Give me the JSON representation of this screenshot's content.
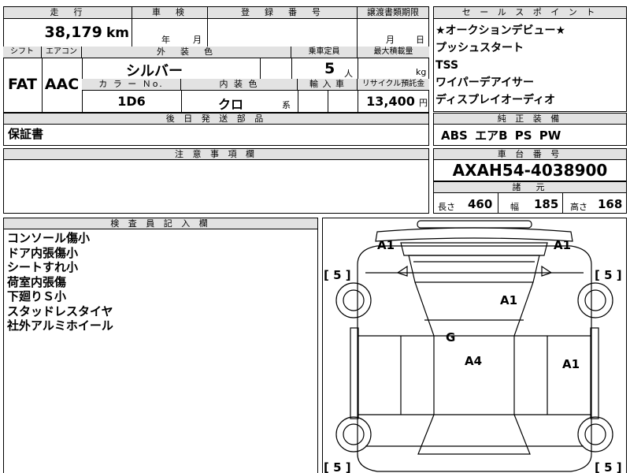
{
  "top_left": {
    "headers": {
      "mileage": "走　行",
      "shaken": "車　検",
      "reg_no": "登　録　番　号",
      "transfer": "譲渡書類期限"
    },
    "mileage_value": "38,179",
    "mileage_unit": "km",
    "shaken_year": "年",
    "shaken_month": "月",
    "transfer_month": "月",
    "transfer_day": "日",
    "row2_headers": {
      "shift": "シフト",
      "aircon": "エアコン",
      "exterior": "外　装　色",
      "capacity": "乗車定員",
      "max_load": "最大積載量"
    },
    "shift": "FAT",
    "aircon": "AAC",
    "exterior_color": "シルバー",
    "capacity_value": "5",
    "capacity_unit": "人",
    "load_unit": "kg",
    "row3_headers": {
      "color_no": "カ ラ ー Ｎo.",
      "interior": "内 装 色",
      "import": "輸 入 車",
      "recycle": "リサイクル預託金"
    },
    "color_no": "1D6",
    "interior_color": "クロ",
    "interior_suffix": "系",
    "recycle_value": "13,400",
    "recycle_unit": "円",
    "delivery_header": "後 日 発 送 部 品",
    "delivery_item": "保証書",
    "notes_header": "注 意 事 項 欄"
  },
  "right": {
    "sales_header": "セ ー ル ス ポ イ ン ト",
    "sales_points": [
      "★オークションデビュー★",
      "プッシュスタート",
      "TSS",
      "ワイパーデアイサー",
      "ディスプレイオーディオ"
    ],
    "equipment_header": "純 正 装 備",
    "equipment": "ABS エアB PS PW",
    "chassis_header": "車 台 番 号",
    "chassis_no": "AXAH54-4038900",
    "spec_header": "諸　元",
    "length_label": "長さ",
    "length": "460",
    "width_label": "幅",
    "width": "185",
    "height_label": "高さ",
    "height": "168"
  },
  "inspector": {
    "header": "検 査 員 記 入 欄",
    "notes": [
      "コンソール傷小",
      "ドア内張傷小",
      "シートすれ小",
      "荷室内張傷",
      "下廻りＳ小",
      "スタッドレスタイヤ",
      "社外アルミホイール"
    ]
  },
  "diagram": {
    "marks": [
      "A1",
      "A1",
      "A1",
      "G",
      "A4",
      "A1"
    ],
    "tires": [
      "[ 5 ]",
      "[ 5 ]",
      "[ 5 ]",
      "[ 5 ]"
    ]
  }
}
